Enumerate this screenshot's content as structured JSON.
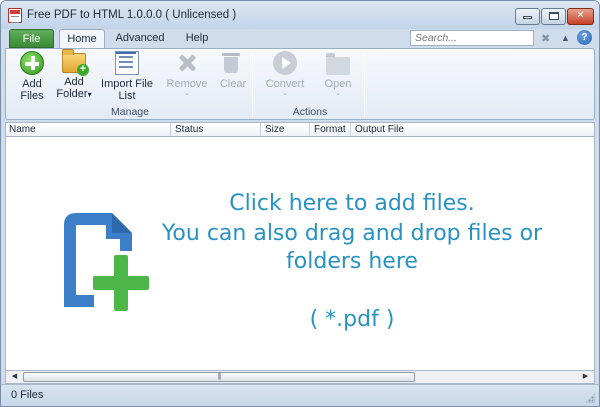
{
  "window": {
    "title": "Free PDF to HTML 1.0.0.0  ( Unlicensed )",
    "min_glyph": "",
    "max_glyph": "",
    "close_glyph": "✕"
  },
  "ribbon_tabs": {
    "file": "File",
    "home": "Home",
    "advanced": "Advanced",
    "help": "Help",
    "search_placeholder": "Search...",
    "help_glyph": "?",
    "close_glyph": "✖",
    "collapse_glyph": "▲"
  },
  "ribbon": {
    "manage": {
      "label": "Manage",
      "add_files": [
        "Add",
        "Files"
      ],
      "add_folder": [
        "Add",
        "Folder"
      ],
      "import_file_list": [
        "Import File",
        "List"
      ]
    },
    "actions": {
      "label": "Actions",
      "remove": "Remove",
      "clear": "Clear",
      "convert": "Convert",
      "open": "Open"
    },
    "dropdown_glyph": "▾",
    "dropdown_disabled_glyph": "⌄"
  },
  "columns": [
    "Name",
    "Status",
    "Size",
    "Format",
    "Output File"
  ],
  "drop_zone": {
    "line1": "Click here to add files.",
    "line2": "You can also drag and drop files or",
    "line3": "folders here",
    "extension": "( *.pdf )"
  },
  "scrollbar": {
    "left_glyph": "◀",
    "right_glyph": "▶",
    "thumb_grip": "|||"
  },
  "status": {
    "text": "0 Files"
  },
  "colors": {
    "accent": "#2a92c2",
    "file_tab": "#3a8a36",
    "icon_blue": "#3c7fc8",
    "icon_green": "#4cb648"
  }
}
